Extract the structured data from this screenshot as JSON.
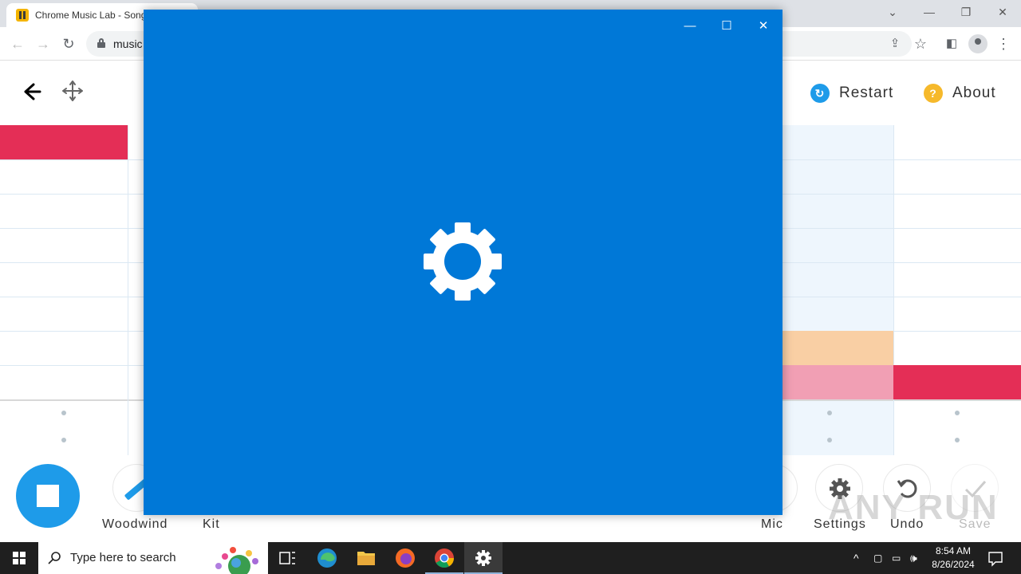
{
  "browser": {
    "tab_title": "Chrome Music Lab - Song",
    "url_visible": "music",
    "window_controls": [
      "—",
      "❐",
      "✕"
    ],
    "tab_dropdown": "⌄"
  },
  "header": {
    "restart_label": "Restart",
    "about_label": "About",
    "about_glyph": "?",
    "restart_glyph": "↻"
  },
  "toolbar": {
    "tools": [
      {
        "label": "Woodwind"
      },
      {
        "label": "Kit"
      },
      {
        "label": "Mic"
      },
      {
        "label": "Settings"
      },
      {
        "label": "Undo"
      },
      {
        "label": "Save"
      }
    ]
  },
  "colors": {
    "accent_blue": "#1e9be9",
    "note_red": "#e42e56",
    "note_peach": "#f9cfa4",
    "note_pink": "#f19fb4",
    "settings_bg": "#0078d7",
    "restart_icon": "#1e9be9",
    "about_icon": "#f6b92b"
  },
  "settings_window": {
    "controls": [
      "—",
      "☐",
      "✕"
    ]
  },
  "watermark": "ANY RUN",
  "taskbar": {
    "search_placeholder": "Type here to search",
    "time": "8:54 AM",
    "date": "8/26/2024",
    "apps": [
      "task-view",
      "edge",
      "file-explorer",
      "firefox",
      "chrome",
      "settings"
    ]
  }
}
